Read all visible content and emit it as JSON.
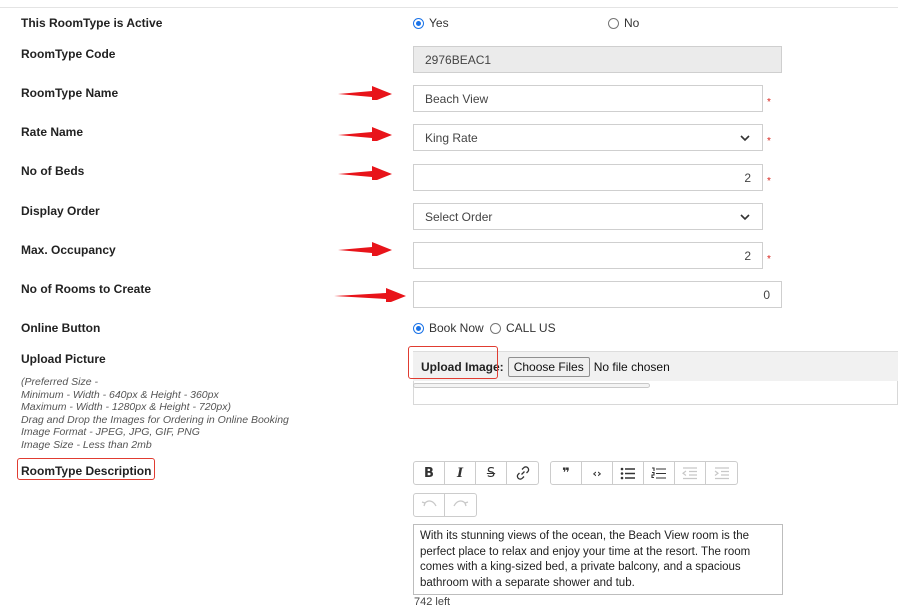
{
  "form": {
    "active": {
      "label": "This RoomType is Active",
      "options": [
        "Yes",
        "No"
      ],
      "selected": "Yes"
    },
    "code": {
      "label": "RoomType Code",
      "value": "2976BEAC1"
    },
    "name": {
      "label": "RoomType Name",
      "value": "Beach View",
      "required": "*"
    },
    "rate": {
      "label": "Rate Name",
      "value": "King Rate",
      "required": "*"
    },
    "beds": {
      "label": "No of Beds",
      "value": "2",
      "required": "*"
    },
    "display_order": {
      "label": "Display Order",
      "value": "Select Order"
    },
    "occupancy": {
      "label": "Max. Occupancy",
      "value": "2",
      "required": "*"
    },
    "rooms_to_create": {
      "label": "No of Rooms to Create",
      "value": "0"
    },
    "online_button": {
      "label": "Online Button",
      "options": [
        "Book Now",
        "CALL US"
      ],
      "selected": "Book Now"
    },
    "upload": {
      "label": "Upload Picture",
      "hint_lines": [
        "(Preferred Size -",
        "Minimum - Width - 640px & Height - 360px",
        "Maximum - Width - 1280px & Height - 720px)",
        "Drag and Drop the Images for Ordering in Online Booking",
        "Image Format - JPEG, JPG, GIF, PNG",
        "Image Size - Less than 2mb"
      ],
      "upload_label": "Upload Image:",
      "choose_button": "Choose Files",
      "file_status": "No file chosen"
    },
    "description": {
      "label": "RoomType Description",
      "text": "With its stunning views of the ocean, the Beach View room is the perfect place to relax and enjoy your time at the resort. The room comes with a king-sized bed, a private balcony, and a spacious bathroom with a separate shower and tub.",
      "counter": "742 left"
    }
  },
  "toolbar": {
    "group1": [
      {
        "name": "bold",
        "glyph": "B"
      },
      {
        "name": "italic",
        "glyph": "I"
      },
      {
        "name": "strikethrough",
        "glyph": "S"
      },
      {
        "name": "link",
        "glyph": "🔗"
      }
    ],
    "group2": [
      {
        "name": "blockquote",
        "glyph": "❞"
      },
      {
        "name": "code",
        "glyph": "‹›"
      },
      {
        "name": "bulleted-list",
        "glyph": "☰"
      },
      {
        "name": "numbered-list",
        "glyph": "☷"
      },
      {
        "name": "outdent",
        "glyph": "⇤"
      },
      {
        "name": "indent",
        "glyph": "⇥"
      }
    ],
    "group3": [
      {
        "name": "undo",
        "glyph": "↶"
      },
      {
        "name": "redo",
        "glyph": "↷"
      }
    ]
  },
  "colors": {
    "arrow": "#e8141a",
    "highlight": "#e03c31",
    "required": "#d9231c",
    "radio": "#1a73e8"
  }
}
